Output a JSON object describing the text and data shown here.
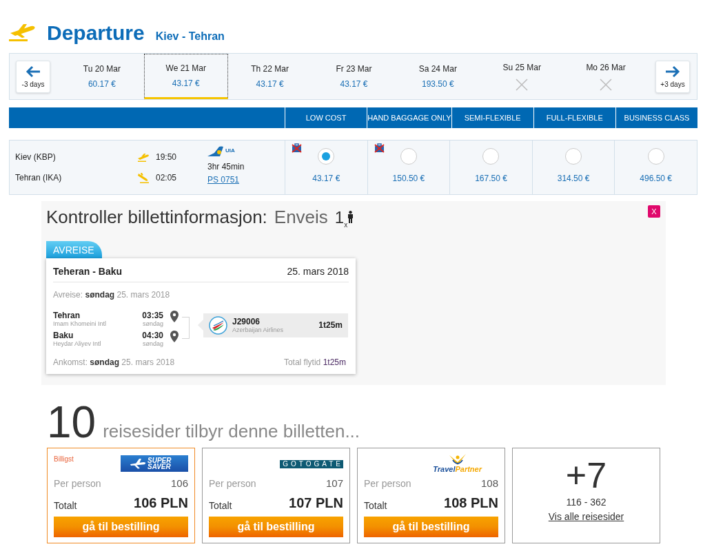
{
  "header": {
    "title": "Departure",
    "route": "Kiev - Tehran"
  },
  "date_strip": {
    "prev": "-3 days",
    "next": "+3 days",
    "dates": [
      {
        "label": "Tu 20 Mar",
        "price": "60.17 €",
        "available": true,
        "selected": false
      },
      {
        "label": "We 21 Mar",
        "price": "43.17 €",
        "available": true,
        "selected": true
      },
      {
        "label": "Th 22 Mar",
        "price": "43.17 €",
        "available": true,
        "selected": false
      },
      {
        "label": "Fr 23 Mar",
        "price": "43.17 €",
        "available": true,
        "selected": false
      },
      {
        "label": "Sa 24 Mar",
        "price": "193.50 €",
        "available": true,
        "selected": false
      },
      {
        "label": "Su 25 Mar",
        "available": false,
        "selected": false
      },
      {
        "label": "Mo 26 Mar",
        "available": false,
        "selected": false
      }
    ]
  },
  "fare_header": [
    "LOW COST",
    "HAND BAGGAGE ONLY",
    "SEMI-FLEXIBLE",
    "FULL-FLEXIBLE",
    "BUSINESS CLASS"
  ],
  "flight": {
    "origin": "Kiev (KBP)",
    "destination": "Tehran (IKA)",
    "departure_time": "19:50",
    "arrival_time": "02:05",
    "airline": "UIA",
    "duration": "3hr 45min",
    "flight_number": "PS 0751",
    "fares": [
      {
        "price": "43.17 €",
        "selected": true,
        "no_checked_bag": true
      },
      {
        "price": "150.50 €",
        "selected": false,
        "no_checked_bag": true
      },
      {
        "price": "167.50 €",
        "selected": false,
        "no_checked_bag": false
      },
      {
        "price": "314.50 €",
        "selected": false,
        "no_checked_bag": false
      },
      {
        "price": "496.50 €",
        "selected": false,
        "no_checked_bag": false
      }
    ]
  },
  "ticket_check": {
    "title": "Kontroller billettinformasjon:",
    "trip_type": "Enveis",
    "passengers": "1$_{x}$",
    "close": "X",
    "leg_tab": "AVREISE",
    "leg": {
      "route": "Teheran - Baku",
      "date": "25. mars 2018",
      "departure_line": "Avreise: **søndag** 25. mars 2018",
      "stops": [
        {
          "city": "Tehran",
          "airport": "Imam Khomeini Intl",
          "time": "03:35",
          "day": "søndag"
        },
        {
          "city": "Baku",
          "airport": "Heydar Aliyev Intl",
          "time": "04:30",
          "day": "søndag"
        }
      ],
      "segment": {
        "number": "J29006",
        "airline": "Azerbaijan Airlines",
        "duration": "1t25m"
      },
      "arrival_line": "Ankomst: **søndag** 25. mars 2018",
      "total_line": "Total flytid **1t25m**"
    }
  },
  "offers": {
    "count": "10",
    "heading": "reisesider tilbyr denne billetten...",
    "sites": [
      {
        "badge": "Billigst",
        "highlighted": true,
        "logo": {
          "kind": "supersaver",
          "text": "SUPER SAVER"
        },
        "per_person_label": "Per person",
        "per_person": "106",
        "total_label": "Totalt",
        "total": "106 PLN",
        "button": "gå til bestilling"
      },
      {
        "highlighted": false,
        "logo": {
          "kind": "gotogate",
          "text": "GOTOGATE"
        },
        "per_person_label": "Per person",
        "per_person": "107",
        "total_label": "Totalt",
        "total": "107 PLN",
        "button": "gå til bestilling"
      },
      {
        "highlighted": false,
        "logo": {
          "kind": "travelpartner",
          "text": "Travel**Partner**"
        },
        "per_person_label": "Per person",
        "per_person": "108",
        "total_label": "Totalt",
        "total": "108 PLN",
        "button": "gå til bestilling"
      }
    ],
    "more": {
      "count": "+7",
      "range": "116 - 362",
      "link": "Vis alle reisesider"
    }
  }
}
